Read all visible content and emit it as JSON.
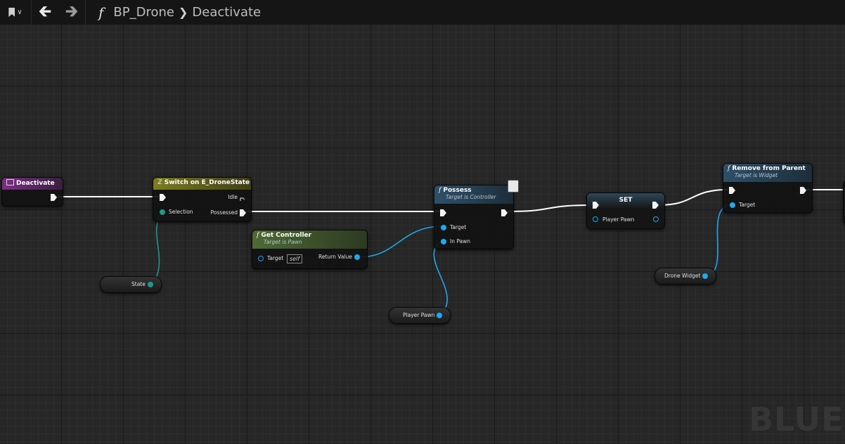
{
  "toolbar": {
    "breadcrumb": [
      "BP_Drone",
      "Deactivate"
    ],
    "icons": [
      "bookmark-icon",
      "chevron-down-icon",
      "back-arrow-icon",
      "forward-arrow-icon",
      "function-icon"
    ]
  },
  "watermark": "BLUE",
  "colors": {
    "event_header": "#7a2f85",
    "switch_header": "#7c7d1e",
    "pure_func_header": "#4d6a34",
    "func_header": "#2e5069",
    "exec_wire": "#ffffff",
    "object_wire": "#1ea8ef",
    "enum_wire": "#1d9a8a"
  },
  "nodes": {
    "deactivate": {
      "title": "Deactivate"
    },
    "switch": {
      "title": "Switch on E_DroneState",
      "pins": {
        "selection": "Selection",
        "idle": "Idle",
        "possessed": "Possessed"
      }
    },
    "state_var": {
      "label": "State"
    },
    "get_controller": {
      "title": "Get Controller",
      "subtitle": "Target is Pawn",
      "target_label": "Target",
      "target_default": "self",
      "return_label": "Return Value"
    },
    "possess": {
      "title": "Possess",
      "subtitle": "Target is Controller",
      "target_label": "Target",
      "in_pawn_label": "In Pawn"
    },
    "player_pawn_var": {
      "label": "Player Pawn"
    },
    "set": {
      "title": "SET",
      "pin_label": "Player Pawn"
    },
    "remove_from_parent": {
      "title": "Remove from Parent",
      "subtitle": "Target is Widget",
      "target_label": "Target"
    },
    "drone_widget_var": {
      "label": "Drone Widget"
    }
  }
}
